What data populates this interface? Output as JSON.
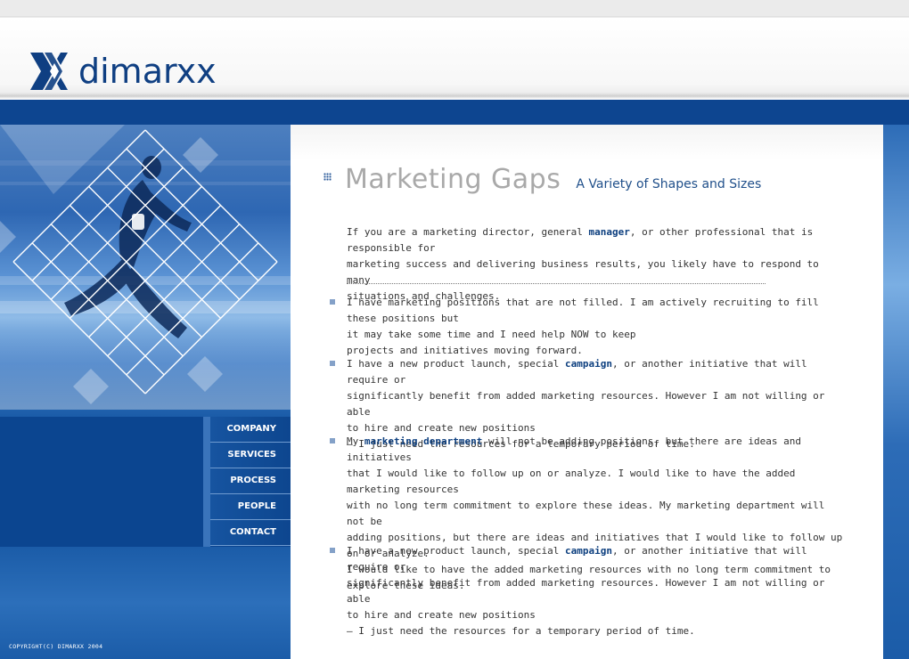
{
  "brand": {
    "name": "dimarxx"
  },
  "nav": {
    "items": [
      "COMPANY",
      "SERVICES",
      "PROCESS",
      "PEOPLE",
      "CONTACT"
    ]
  },
  "footer": {
    "copyright": "COPYRIGHT(C) DIMARXX 2004"
  },
  "main": {
    "title": "Marketing Gaps",
    "subtitle": "A Variety of Shapes and Sizes",
    "intro": {
      "a": "If you are a marketing director, general ",
      "strong": "manager",
      "b": ", or other professional that is responsible for\nmarketing success and delivering business results, you likely have  to respond to many\nsituations and challenges."
    },
    "bullets": [
      {
        "a": "I have marketing positions that are not filled. I am actively recruiting to fill these positions but\nit may take some time and I need help NOW to keep\nprojects and initiatives moving forward.",
        "strong": "",
        "b": ""
      },
      {
        "a": "I have a new product launch, special ",
        "strong": "campaign",
        "b": ", or another initiative that will require or\nsignificantly benefit from added marketing resources.  However I am not willing or able\nto hire and create new positions\n– I just need the resources for a temporary period of time."
      },
      {
        "a": "My ",
        "strong": "marketing department",
        "b": " will not be adding positions, but there are ideas and initiatives\nthat I would like to follow up on or analyze.  I would like to have the added marketing resources\nwith no long term commitment to explore these ideas. My marketing department will not be\nadding positions, but there are ideas and initiatives that I would like to follow up on or analyze.\nI would like to have the added marketing resources with no long term commitment to\nexplore these ideas."
      },
      {
        "a": "I have a new product launch, special ",
        "strong": "campaign",
        "b": ", or another initiative that will require or\nsignificantly benefit from added marketing resources.  However I am not willing or able\nto hire and create new positions\n– I just need the resources for a temporary period of time."
      }
    ]
  },
  "colors": {
    "brand_blue": "#0f3f82",
    "title_gray": "#a9a9a9",
    "link_blue": "#0d3f7f",
    "nav_bg": "#0b4590"
  }
}
